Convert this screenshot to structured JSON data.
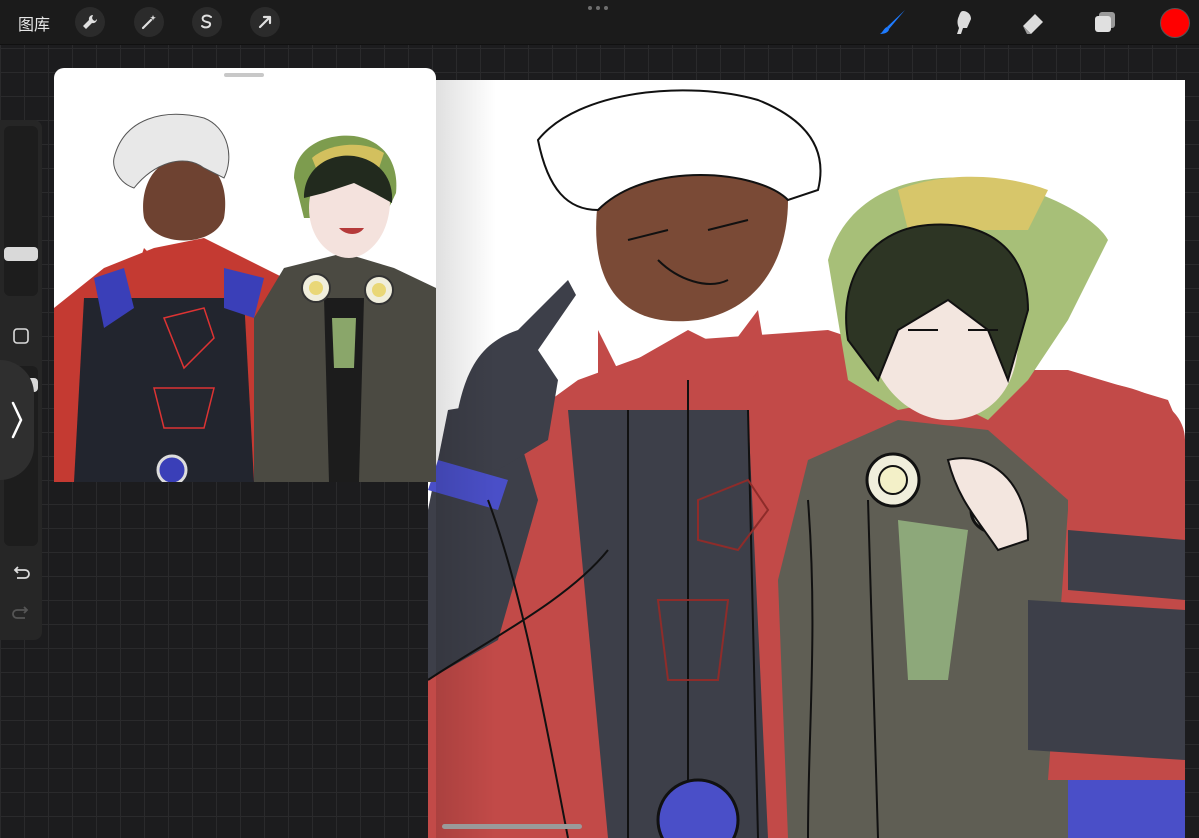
{
  "toolbar": {
    "gallery_label": "图库",
    "left_tools": [
      "wrench-icon",
      "magic-wand-icon",
      "selection-icon",
      "transform-arrow-icon"
    ],
    "right_tools": [
      "brush-icon",
      "smudge-icon",
      "eraser-icon",
      "layers-icon"
    ],
    "active_tool": "brush-icon",
    "brush_color": "#1e7bff",
    "current_color": "#ff0000"
  },
  "sidebar": {
    "brush_size": 0.8,
    "opacity": 0.2,
    "icons": [
      "square-modify-icon",
      "chevron-right-icon",
      "undo-icon",
      "redo-icon"
    ]
  },
  "colors": {
    "jacket_red": "#c24a48",
    "jacket_dark": "#3d3f49",
    "accent_blue": "#4a4fc8",
    "hood_green": "#a7bf78",
    "hood_yellow": "#d7c66a",
    "coat_grey": "#5f5e54",
    "skin_dark": "#7a4a36",
    "skin_light": "#f3e6df"
  }
}
